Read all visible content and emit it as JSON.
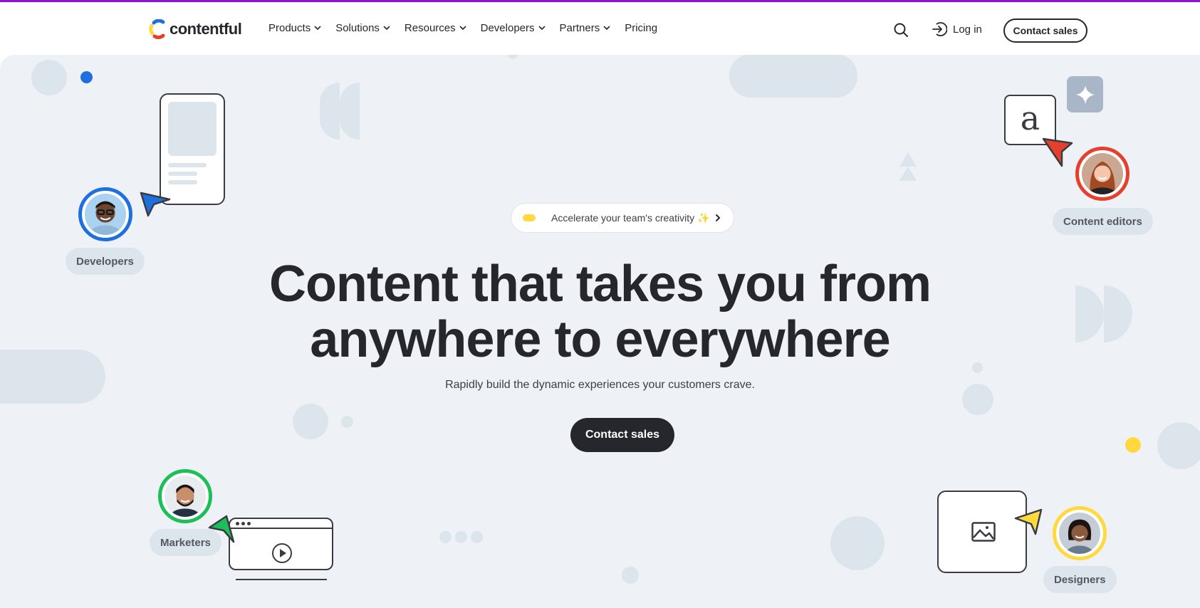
{
  "brand": {
    "name": "contentful",
    "accent_bar": "#8b12e0"
  },
  "nav": {
    "items": [
      {
        "label": "Products",
        "has_dropdown": true
      },
      {
        "label": "Solutions",
        "has_dropdown": true
      },
      {
        "label": "Resources",
        "has_dropdown": true
      },
      {
        "label": "Developers",
        "has_dropdown": true
      },
      {
        "label": "Partners",
        "has_dropdown": true
      },
      {
        "label": "Pricing",
        "has_dropdown": false
      }
    ],
    "search_icon": "search-icon",
    "login_label": "Log in",
    "login_icon": "login-arrow-icon",
    "cta_label": "Contact sales"
  },
  "hero": {
    "announcement": {
      "text": "Accelerate your team's creativity ✨",
      "icon": "chevron-right-icon"
    },
    "title_line1": "Content that takes you from",
    "title_line2": "anywhere to everywhere",
    "subtitle": "Rapidly build the dynamic experiences your customers crave.",
    "cta_label": "Contact sales"
  },
  "personas": [
    {
      "label": "Developers",
      "color": "#1e6fe0"
    },
    {
      "label": "Content editors",
      "color": "#e5402e"
    },
    {
      "label": "Marketers",
      "color": "#1dbf59"
    },
    {
      "label": "Designers",
      "color": "#ffd93d"
    }
  ],
  "illustrations": {
    "editor_letter": "a",
    "sparkle_icon": "sparkle-icon",
    "image_icon": "image-icon",
    "play_icon": "play-icon"
  }
}
